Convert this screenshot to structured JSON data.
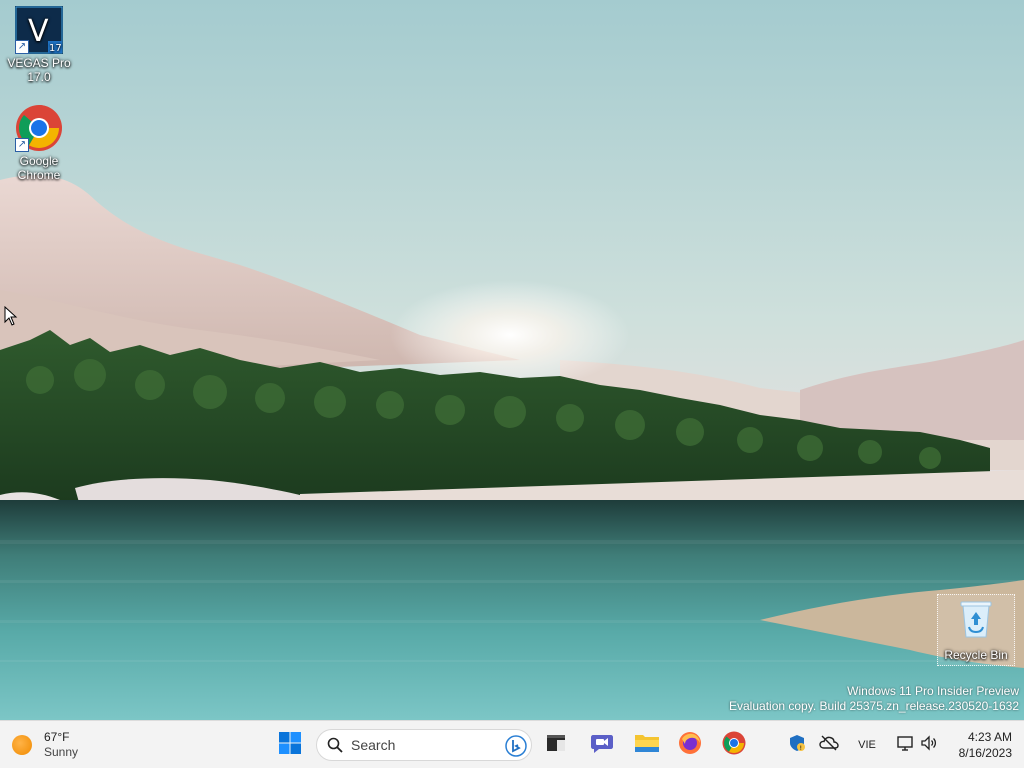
{
  "desktop": {
    "icons": [
      {
        "label": "VEGAS Pro 17.0",
        "icon": "vegas-pro-icon",
        "badge": "17"
      },
      {
        "label": "Google Chrome",
        "icon": "chrome-icon"
      },
      {
        "label": "Recycle Bin",
        "icon": "recycle-bin-icon"
      }
    ],
    "watermark": {
      "line1": "Windows 11 Pro Insider Preview",
      "line2": "Evaluation copy. Build 25375.zn_release.230520-1632"
    }
  },
  "taskbar": {
    "weather": {
      "temperature": "67°F",
      "condition": "Sunny",
      "icon": "sun-icon"
    },
    "search": {
      "placeholder": "Search"
    },
    "pinned_apps": [
      {
        "name": "start",
        "icon": "windows-start-icon"
      },
      {
        "name": "bing",
        "icon": "bing-icon"
      },
      {
        "name": "terminal",
        "icon": "terminal-icon"
      },
      {
        "name": "teams",
        "icon": "teams-chat-icon"
      },
      {
        "name": "file-explorer",
        "icon": "folder-icon"
      },
      {
        "name": "firefox",
        "icon": "firefox-icon"
      },
      {
        "name": "chrome",
        "icon": "chrome-icon"
      }
    ],
    "tray": {
      "language": "VIE",
      "icons": [
        "security-shield-icon",
        "cloud-offline-icon",
        "network-icon",
        "volume-icon"
      ]
    },
    "clock": {
      "time": "4:23 AM",
      "date": "8/16/2023"
    }
  },
  "colors": {
    "taskbar_bg": "#f3f3f3",
    "accent": "#0078d4",
    "sky": "#a9cfd2",
    "water": "#4f9e9e"
  }
}
